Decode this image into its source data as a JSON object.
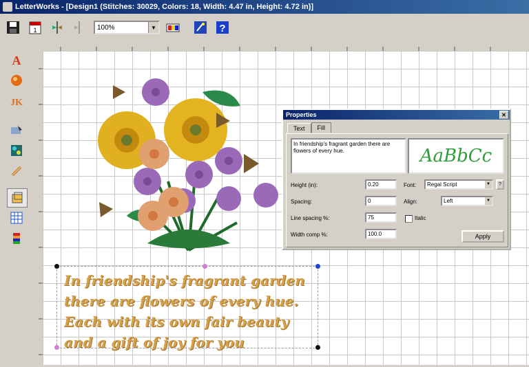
{
  "window": {
    "title": "LetterWorks - [Design1 (Stitches: 30029, Colors: 18, Width: 4.47 in, Height: 4.72 in)]"
  },
  "toolbar": {
    "zoom_value": "100%"
  },
  "canvas": {
    "lettering_lines": [
      "In friendship's fragrant garden",
      "there are flowers of every hue.",
      "Each with its own fair beauty",
      "and a gift of joy for you"
    ]
  },
  "properties": {
    "title": "Properties",
    "tabs": [
      "Text",
      "Fill"
    ],
    "text_value": "In friendship's fragrant garden there are flowers of every hue.",
    "preview_text": "AaBbCc",
    "height_label": "Height (in):",
    "height_value": "0.20",
    "spacing_label": "Spacing:",
    "spacing_value": "0",
    "line_spacing_label": "Line spacing %:",
    "line_spacing_value": "75",
    "width_comp_label": "Width comp %:",
    "width_comp_value": "100.0",
    "font_label": "Font:",
    "font_value": "Regal Script",
    "align_label": "Align:",
    "align_value": "Left",
    "italic_label": "Italic",
    "apply_label": "Apply"
  },
  "colors": {
    "title_bar": "#0a246a",
    "lettering": "#d4a14a",
    "preview_green": "#2e9e3c"
  },
  "icons": [
    "save-icon",
    "calendar-icon",
    "mirror-icon",
    "mirror-disabled-icon",
    "color-palette-icon",
    "wizard-icon",
    "help-icon",
    "lettering-tool-icon",
    "appliqué-icon",
    "monogram-icon",
    "select-tool-icon",
    "motif-icon",
    "stitch-tool-icon",
    "frame-icon",
    "grid-icon",
    "color-sequence-icon"
  ]
}
